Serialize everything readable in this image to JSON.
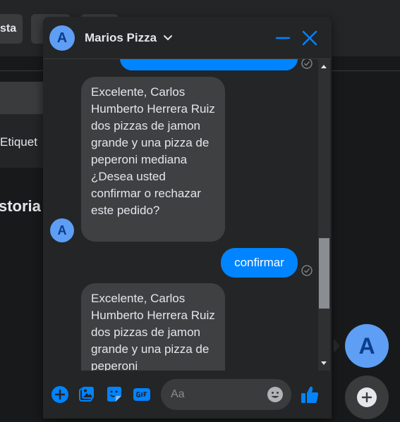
{
  "background": {
    "button_fragment": "sta",
    "tag_fragment": "Etiquet",
    "history_fragment": "storia"
  },
  "chat": {
    "title": "Marios Pizza",
    "avatar_letter": "A",
    "top_partial_message": "",
    "messages": [
      {
        "from": "page",
        "text": "Excelente, Carlos Humberto Herrera Ruiz dos pizzas de jamon grande y una pizza de peperoni mediana  ¿Desea usted confirmar o rechazar este pedido?"
      },
      {
        "from": "user",
        "text": "confirmar"
      },
      {
        "from": "page",
        "text": "Excelente, Carlos Humberto Herrera Ruiz dos pizzas de jamon grande y una pizza de peperoni"
      }
    ],
    "composer": {
      "placeholder": "Aa"
    }
  },
  "floating": {
    "avatar_letter": "A"
  },
  "colors": {
    "accent": "#0084ff",
    "bubble_in": "#3e4042",
    "panel": "#242526",
    "avatar": "#5e9ef4"
  }
}
